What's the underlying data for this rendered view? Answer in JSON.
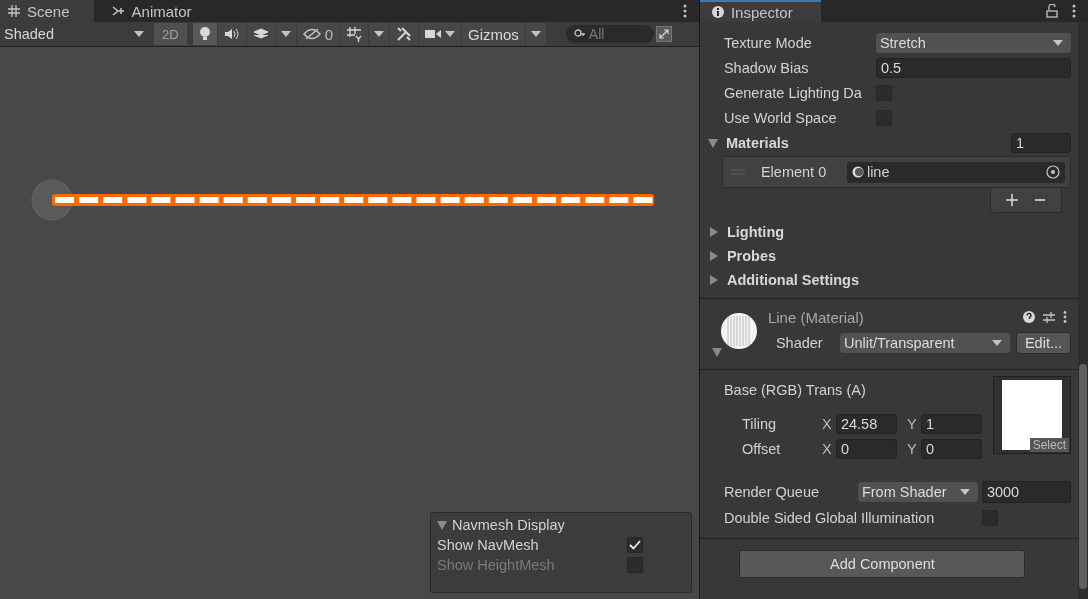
{
  "scene_panel": {
    "tabs": [
      {
        "label": "Scene",
        "kind": "scene",
        "selected": true
      },
      {
        "label": "Animator",
        "kind": "animator",
        "selected": false
      }
    ],
    "toolbar": {
      "draw_mode": "Shaded",
      "two_d": "2D",
      "hidden_count": "0",
      "gizmos": "Gizmos",
      "search_placeholder": "All"
    },
    "navmesh_overlay": {
      "title": "Navmesh Display",
      "expanded": true,
      "options": [
        {
          "label": "Show NavMesh",
          "checked": true,
          "disabled": false
        },
        {
          "label": "Show HeightMesh",
          "checked": false,
          "disabled": true
        }
      ]
    }
  },
  "inspector": {
    "tab": {
      "label": "Inspector",
      "selected": true
    },
    "properties": [
      {
        "kind": "dropdown",
        "label": "Texture Mode",
        "value": "Stretch"
      },
      {
        "kind": "field",
        "label": "Shadow Bias",
        "value": "0.5"
      },
      {
        "kind": "checkbox",
        "label": "Generate Lighting Da",
        "checked": false
      },
      {
        "kind": "checkbox",
        "label": "Use World Space",
        "checked": false
      }
    ],
    "materials": {
      "label": "Materials",
      "expanded": true,
      "count": "1",
      "elements": [
        {
          "label": "Element 0",
          "value": "line"
        }
      ]
    },
    "sections": [
      {
        "label": "Lighting",
        "expanded": false
      },
      {
        "label": "Probes",
        "expanded": false
      },
      {
        "label": "Additional Settings",
        "expanded": false
      }
    ],
    "material": {
      "title": "Line (Material)",
      "expanded": true,
      "shader_label": "Shader",
      "shader": "Unlit/Transparent",
      "edit": "Edit...",
      "texture_label": "Base (RGB) Trans (A)",
      "vectors": [
        {
          "label": "Tiling",
          "fields": [
            {
              "axis": "X",
              "value": "24.58"
            },
            {
              "axis": "Y",
              "value": "1"
            }
          ]
        },
        {
          "label": "Offset",
          "fields": [
            {
              "axis": "X",
              "value": "0"
            },
            {
              "axis": "Y",
              "value": "0"
            }
          ]
        }
      ],
      "select": "Select",
      "render_queue": {
        "label": "Render Queue",
        "mode": "From Shader",
        "value": "3000"
      },
      "double_sided": {
        "label": "Double Sided Global Illumination",
        "checked": false
      }
    },
    "add_component": "Add Component"
  }
}
